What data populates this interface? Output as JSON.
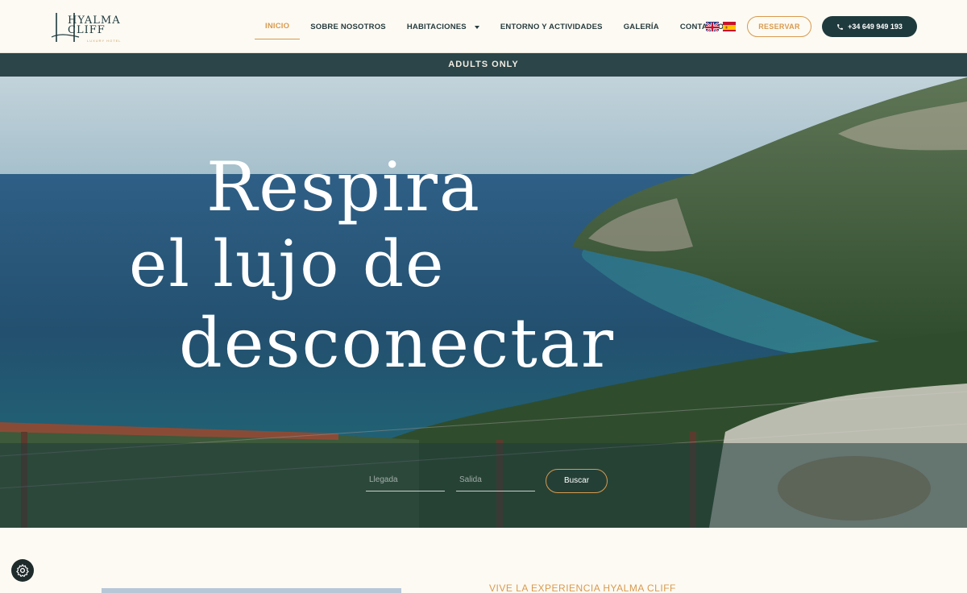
{
  "brand": {
    "name": "HYALMA CLIFF",
    "subtitle": "LUXURY HOTEL"
  },
  "nav": {
    "items": [
      {
        "label": "INICIO",
        "active": true
      },
      {
        "label": "SOBRE NOSOTROS",
        "active": false
      },
      {
        "label": "HABITACIONES",
        "active": false,
        "dropdown": true
      },
      {
        "label": "ENTORNO Y ACTIVIDADES",
        "active": false
      },
      {
        "label": "GALERÍA",
        "active": false
      },
      {
        "label": "CONTACTO",
        "active": false
      }
    ],
    "languages": [
      {
        "flag": "uk-flag-icon"
      },
      {
        "flag": "spain-flag-icon"
      }
    ],
    "reservar_label": "RESERVAR",
    "phone_label": "+34 649 949 193"
  },
  "hero": {
    "banner": "ADULTS ONLY",
    "headline_line1": "Respira",
    "headline_line2": "el lujo de",
    "headline_line3": "desconectar"
  },
  "booking": {
    "arrival_placeholder": "Llegada",
    "departure_placeholder": "Salida",
    "search_label": "Buscar"
  },
  "intro": {
    "section_title": "VIVE LA EXPERIENCIA HYALMA CLIFF"
  },
  "colors": {
    "brand_dark": "#1f3a3d",
    "accent_gold": "#d89a4e",
    "background": "#fdfaf3"
  },
  "icons": {
    "phone": "phone-icon",
    "cookie_settings": "cookie-settings-icon",
    "dropdown": "chevron-down-icon"
  }
}
